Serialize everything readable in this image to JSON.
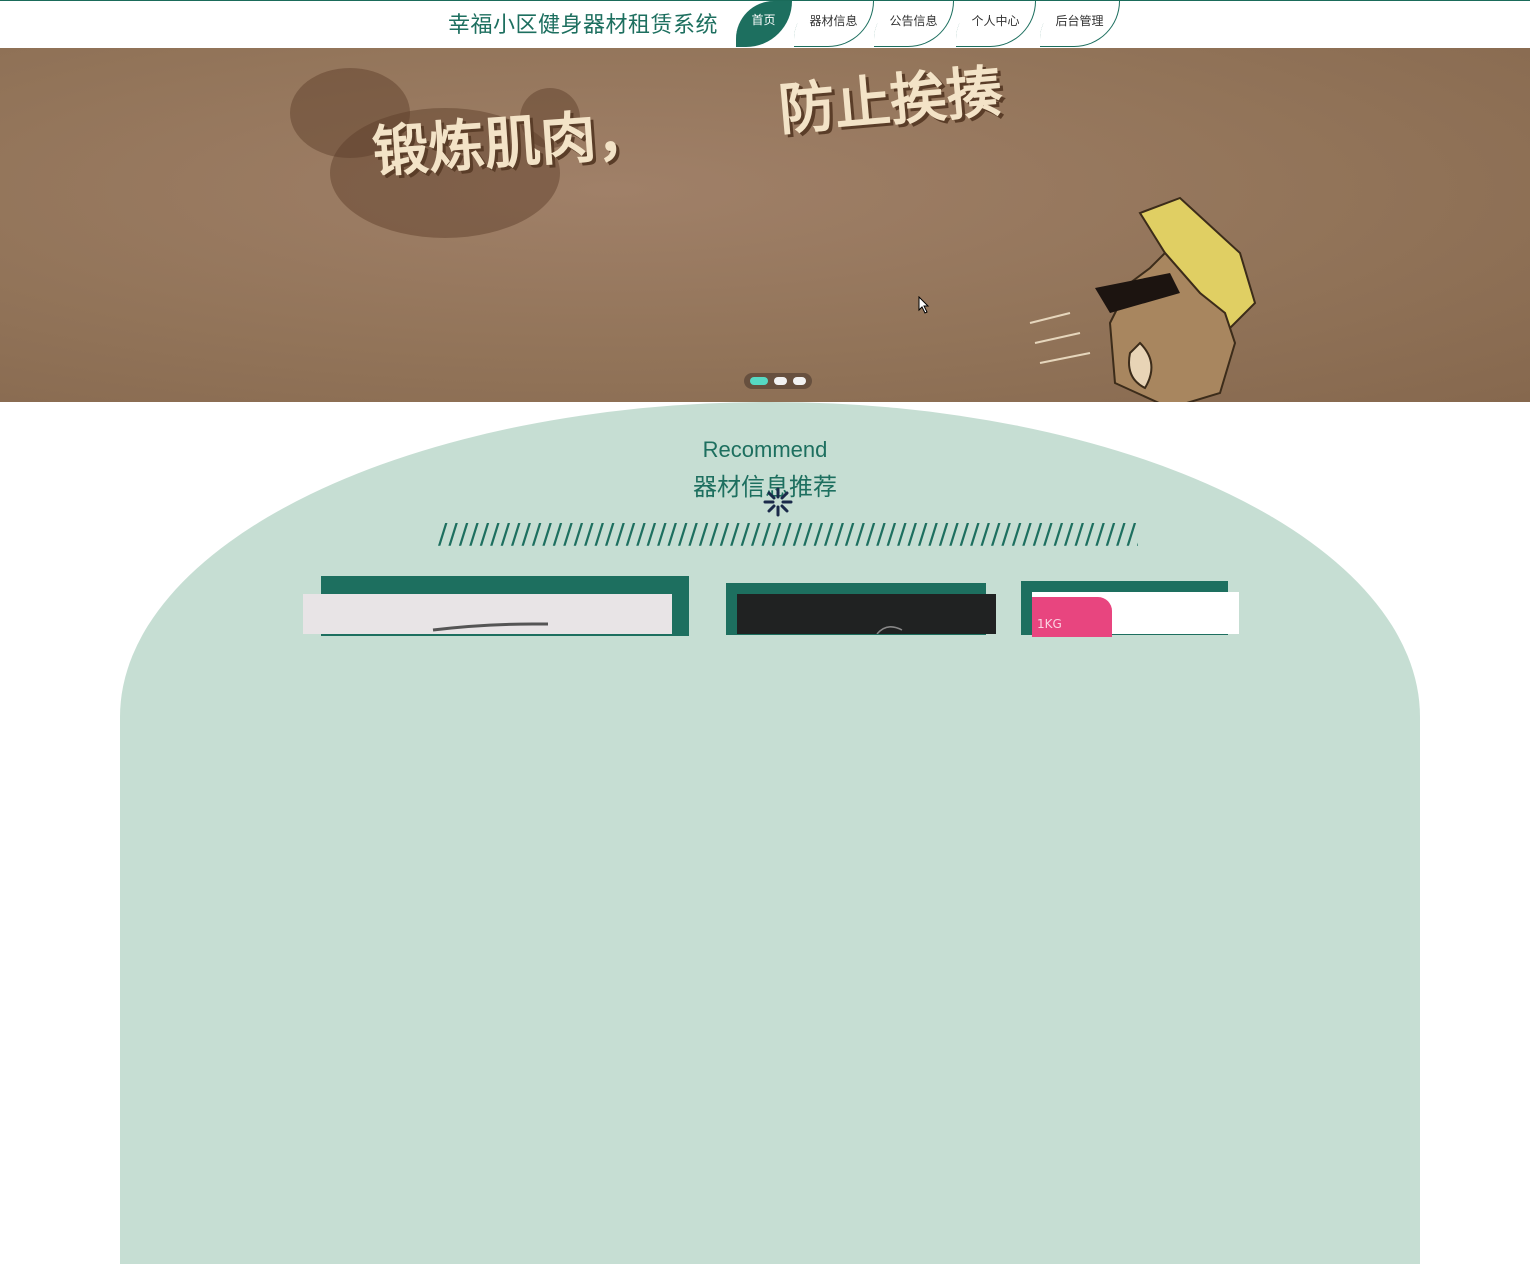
{
  "header": {
    "site_title": "幸福小区健身器材租赁系统",
    "nav": [
      {
        "label": "首页",
        "active": true
      },
      {
        "label": "器材信息",
        "active": false
      },
      {
        "label": "公告信息",
        "active": false
      },
      {
        "label": "个人中心",
        "active": false
      },
      {
        "label": "后台管理",
        "active": false
      }
    ]
  },
  "banner": {
    "line1": "锻炼肌肉，",
    "line2": "防止挨揍",
    "slides": 3,
    "active_slide": 1
  },
  "recommend": {
    "title_en": "Recommend",
    "title_cn": "器材信息推荐",
    "divider": "//////////////////////////////////////////////////////////////////////"
  },
  "products": [
    {
      "image_label": ""
    },
    {
      "image_label": ""
    },
    {
      "image_label": "1KG"
    }
  ],
  "colors": {
    "primary": "#1d6f5f",
    "arc": "#c6ded3",
    "banner": "#927459",
    "active_dot": "#56d9c3"
  }
}
